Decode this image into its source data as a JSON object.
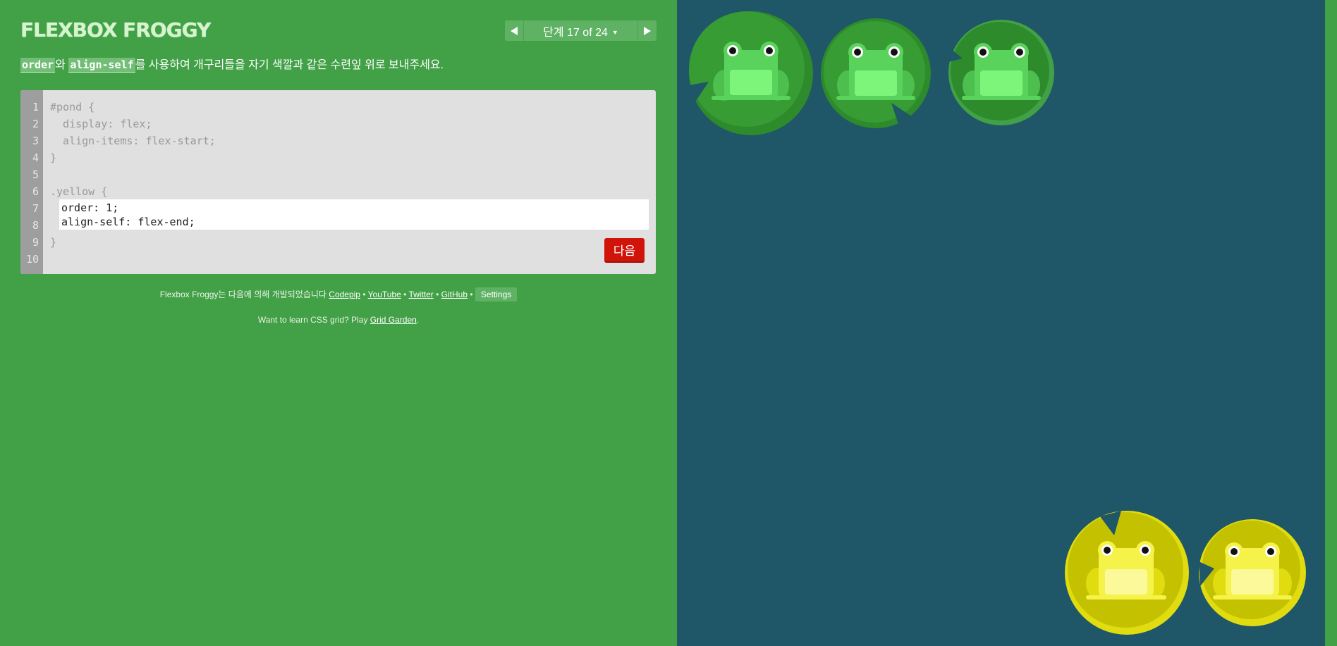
{
  "header": {
    "title": "FLEXBOX FROGGY"
  },
  "level_nav": {
    "prev_icon": "triangle-left-icon",
    "label": "단계 17 of 24",
    "caret": "▼",
    "next_icon": "triangle-right-icon"
  },
  "instructions": {
    "code1": "order",
    "text1": "와 ",
    "code2": "align-self",
    "text2": "를 사용하여 개구리들을 자기 색깔과 같은 수련잎 위로 보내주세요."
  },
  "editor": {
    "line_numbers": [
      "1",
      "2",
      "3",
      "4",
      "5",
      "6",
      "7",
      "8",
      "9",
      "10"
    ],
    "lines": {
      "l1": "#pond {",
      "l2": "  display: flex;",
      "l3": "  align-items: flex-start;",
      "l4": "}",
      "l6": ".yellow {",
      "l9": "}"
    },
    "input_value": "order: 1;\nalign-self: flex-end;",
    "next_label": "다음"
  },
  "footer": {
    "credits_text": "Flexbox Froggy는 다음에 의해 개발되었습니다 ",
    "link_codepip": "Codepip",
    "link_youtube": "YouTube",
    "link_twitter": "Twitter",
    "link_github": "GitHub",
    "sep": " • ",
    "settings_label": "Settings",
    "grid_text": "Want to learn CSS grid? Play ",
    "grid_link": "Grid Garden",
    "grid_end": "."
  },
  "colors": {
    "background": "#42a047",
    "pond": "#1f5768",
    "green_frog": "#5ad35c",
    "yellow_frog": "#f5f24a",
    "next_button": "#d0140a"
  }
}
